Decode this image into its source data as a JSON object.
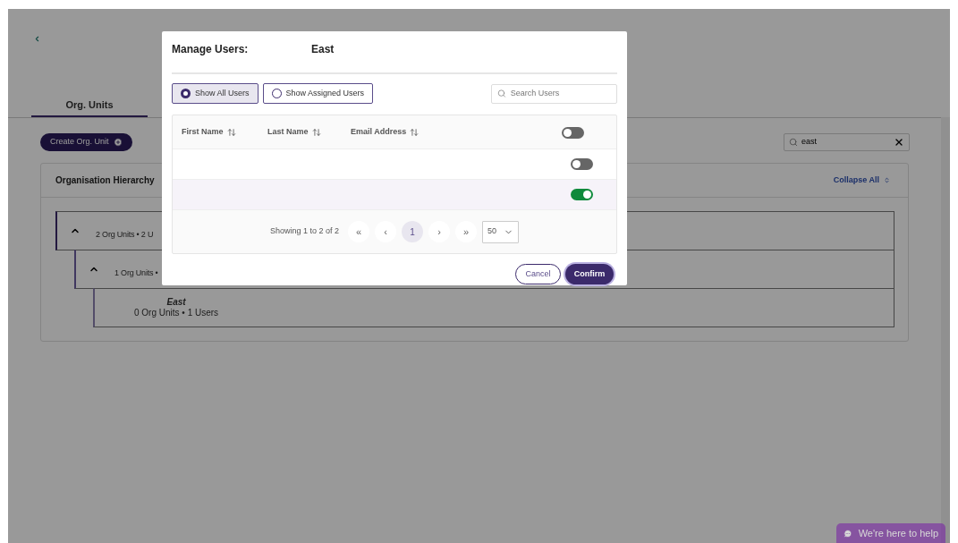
{
  "page": {
    "tabs": [
      {
        "label": "Org. Units",
        "selected": true
      }
    ],
    "create_button": "Create Org. Unit",
    "search": {
      "value": "east"
    },
    "hierarchy": {
      "title": "Organisation Hierarchy",
      "collapse_all": "Collapse All",
      "tree": [
        {
          "summary": "2 Org Units • 2 U",
          "expanded": true,
          "children": [
            {
              "summary": "1 Org Units •",
              "expanded": true,
              "children": [
                {
                  "name": "East",
                  "summary": "0 Org Units • 1 Users"
                }
              ]
            }
          ]
        }
      ]
    },
    "help_button": "We're here to help"
  },
  "dialog": {
    "title": "Manage Users:",
    "unit": "East",
    "filters": [
      {
        "label": "Show All Users",
        "selected": true
      },
      {
        "label": "Show Assigned Users",
        "selected": false
      }
    ],
    "search": {
      "placeholder": "Search Users"
    },
    "table": {
      "columns": [
        "First Name",
        "Last Name",
        "Email Address"
      ],
      "select_all_on": false,
      "rows": [
        {
          "on": false
        },
        {
          "on": true
        }
      ]
    },
    "pagination": {
      "summary": "Showing 1 to 2 of 2",
      "first": "«",
      "prev": "‹",
      "pages": [
        {
          "label": "1",
          "selected": true
        }
      ],
      "next": "›",
      "last": "»",
      "page_size": "50"
    },
    "buttons": {
      "cancel": "Cancel",
      "confirm": "Confirm"
    }
  }
}
